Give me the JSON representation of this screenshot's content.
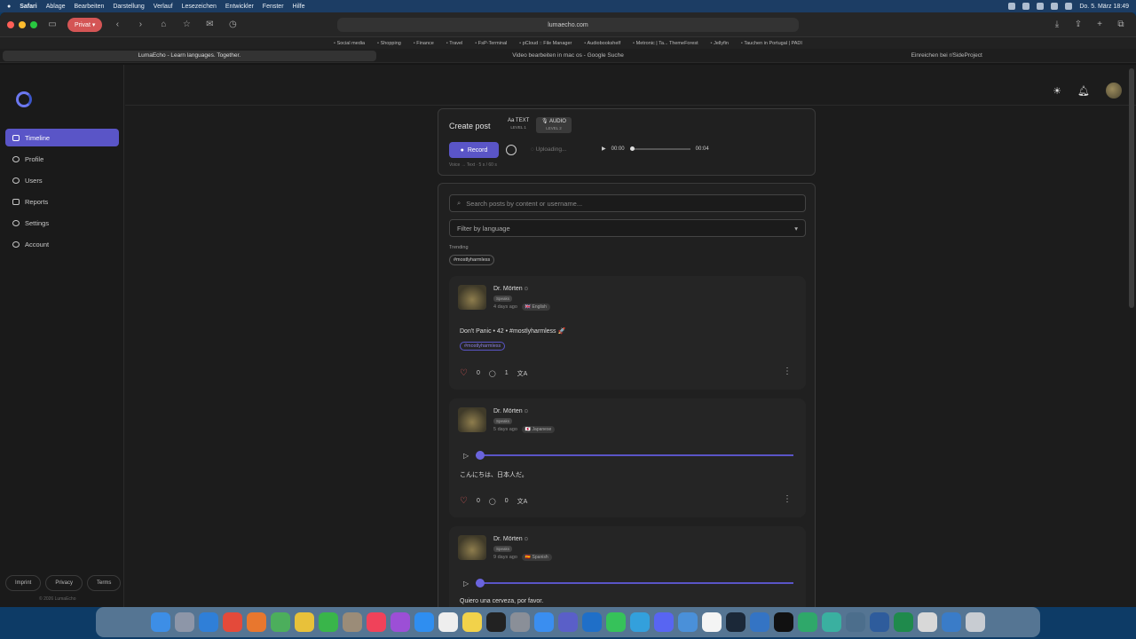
{
  "menubar": {
    "items": [
      "Safari",
      "Ablage",
      "Bearbeiten",
      "Darstellung",
      "Verlauf",
      "Lesezeichen",
      "Entwickler",
      "Fenster",
      "Hilfe"
    ],
    "clock": "Do. 5. März  18:49"
  },
  "browser": {
    "private_label": "Privat",
    "url": "lumaecho.com",
    "favorites": [
      "Social media",
      "Shopping",
      "Finance",
      "Travel",
      "FsP-Terminal",
      "pCloud :: File Manager",
      "Audiobookshelf",
      "Metronic | Ta... ThemeForest",
      "Jellyfin",
      "Tauchen in Portugal | PADI"
    ],
    "tabs": [
      "LumaEcho - Learn languages. Together.",
      "Video bearbeiten in mac os - Google Suche",
      "Einreichen bei r/SideProject"
    ]
  },
  "sidebar": {
    "items": [
      {
        "label": "Timeline",
        "icon": "timeline-icon"
      },
      {
        "label": "Profile",
        "icon": "user-icon"
      },
      {
        "label": "Users",
        "icon": "users-icon"
      },
      {
        "label": "Reports",
        "icon": "flag-icon"
      },
      {
        "label": "Settings",
        "icon": "gear-icon"
      },
      {
        "label": "Account",
        "icon": "account-icon"
      }
    ],
    "footer": [
      "Imprint",
      "Privacy",
      "Terms"
    ],
    "copyright": "© 2026 LumaEcho"
  },
  "create_post": {
    "title": "Create post",
    "text_mode": {
      "label": "Aa TEXT",
      "level": "LEVEL 1"
    },
    "audio_mode": {
      "label": "AUDIO",
      "level": "LEVEL 2"
    },
    "record_label": "Record",
    "uploading_label": "Uploading...",
    "time_start": "00:00",
    "time_end": "00:04",
    "voice_note": "Voice → Text · 5 s / 60 s"
  },
  "feed": {
    "search_placeholder": "Search posts by content or username...",
    "filter_placeholder": "Filter by language",
    "trending_label": "Trending",
    "trending_tag": "#mostlyharmless",
    "posts": [
      {
        "author": "Dr. Mörten",
        "badge": "Speaks",
        "time": "4 days ago",
        "language": "English",
        "text": "Don't Panic • 42 • #mostlyharmless 🚀",
        "tag": "#mostlyharmless",
        "likes": "0",
        "comments": "1"
      },
      {
        "author": "Dr. Mörten",
        "badge": "Speaks",
        "time": "5 days ago",
        "language": "Japanese",
        "text": "こんにちは、日本人だ。",
        "likes": "0",
        "comments": "0"
      },
      {
        "author": "Dr. Mörten",
        "badge": "Speaks",
        "time": "9 days ago",
        "language": "Spanish",
        "text": "Quiero una cerveza, por favor."
      }
    ]
  },
  "colors": {
    "accent": "#5a55c7",
    "heart": "#e05a5a",
    "background": "#1c1c1c"
  }
}
